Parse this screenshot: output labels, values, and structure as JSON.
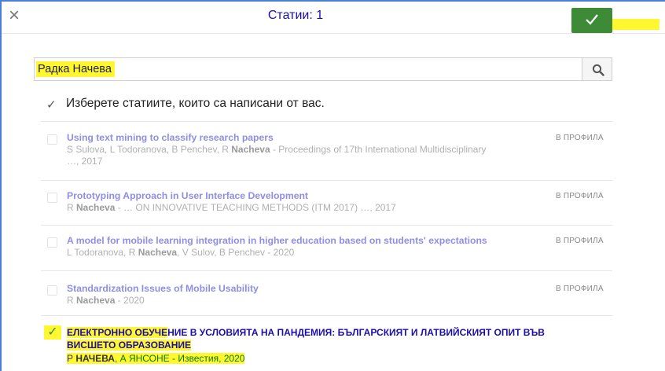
{
  "dialog": {
    "title": "Статии: 1"
  },
  "search": {
    "value": "Радка Начева"
  },
  "instruction": "Изберете статиите, които са написани от вас.",
  "articles": [
    {
      "title": "Using text mining to classify research papers",
      "meta_prefix": "S Sulova, L Todoranova, B Penchev, R ",
      "meta_bold": "Nacheva",
      "meta_suffix": " - Proceedings of 17th International Multidisciplinary …, 2017",
      "badge": "В ПРОФИЛА"
    },
    {
      "title": "Prototyping Approach in User Interface Development",
      "meta_prefix": "R ",
      "meta_bold": "Nacheva",
      "meta_suffix": " - … ON INNOVATIVE TEACHING METHODS (ITM 2017) …, 2017",
      "badge": "В ПРОФИЛА"
    },
    {
      "title": "A model for mobile learning integration in higher education based on students' expectations",
      "meta_prefix": "L Todoranova, R ",
      "meta_bold": "Nacheva",
      "meta_suffix": ", V Sulov, B Penchev - 2020",
      "badge": "В ПРОФИЛА"
    },
    {
      "title": "Standardization Issues of Mobile Usability",
      "meta_prefix": "R ",
      "meta_bold": "Nacheva",
      "meta_suffix": " - 2020",
      "badge": "В ПРОФИЛА"
    }
  ],
  "selected_article": {
    "title_line1_hl": "ЕЛЕКТРОННО ОБУЧЕ",
    "title_line1_rest": "НИЕ В УСЛОВИЯТА НА ПАНДЕМИЯ: БЪЛГАРСКИЯТ И ЛАТВИЙСКИЯТ ОПИТ ВЪВ",
    "title_line2_hl": "ВИСШЕТО ОБРАЗОВАНИЕ",
    "meta_prefix": "Р ",
    "meta_bold": "НАЧЕВА",
    "meta_suffix": ", А ЯНСОНЕ - Известия, 2020"
  },
  "colors": {
    "accent": "#1a0dab",
    "ok_button": "#3d8b37",
    "highlight": "#fff830",
    "faded_link": "#8f8ee6"
  },
  "icons": {
    "close": "close-icon",
    "confirm": "check-icon",
    "search": "search-icon",
    "select_all": "checkmark-icon"
  }
}
